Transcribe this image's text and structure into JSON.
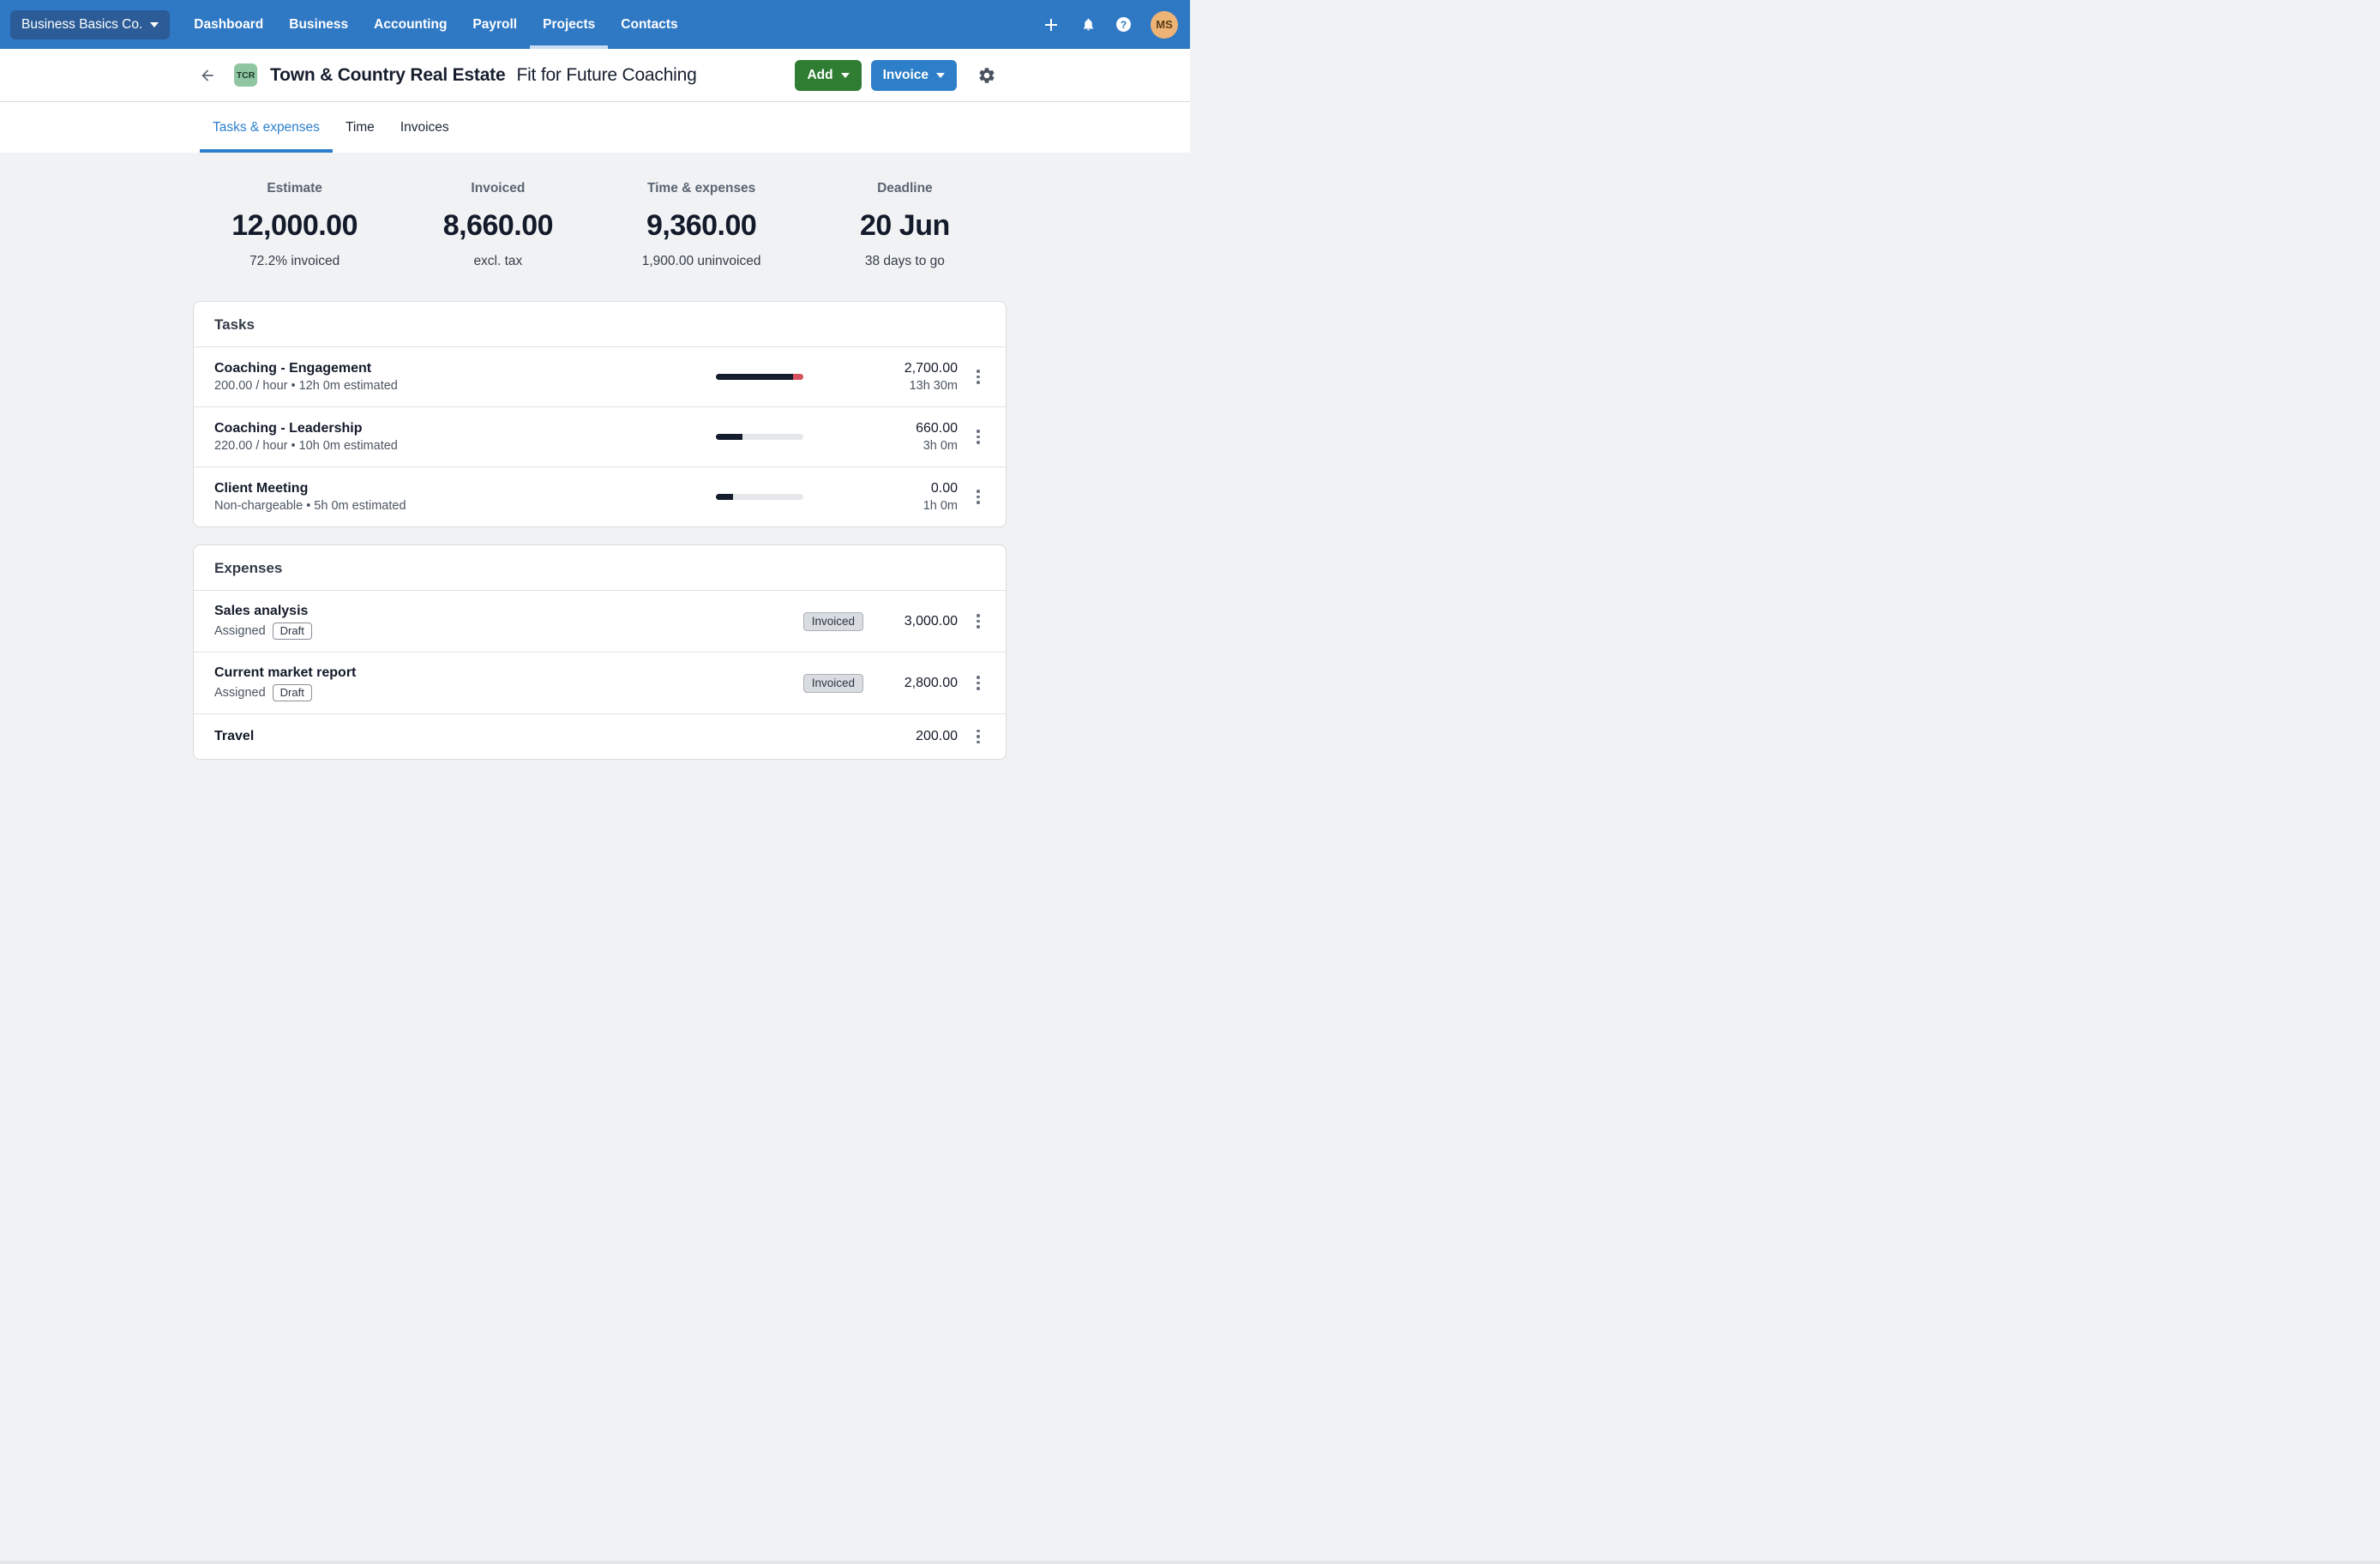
{
  "nav": {
    "org_label": "Business Basics Co.",
    "items": [
      "Dashboard",
      "Business",
      "Accounting",
      "Payroll",
      "Projects",
      "Contacts"
    ],
    "active_item": "Projects",
    "icons": [
      "plus-icon",
      "bell-icon",
      "help-icon"
    ],
    "avatar_initials": "MS"
  },
  "header": {
    "badge": "TCR",
    "title": "Town & Country Real Estate",
    "subtitle": "Fit for Future Coaching",
    "add_label": "Add",
    "invoice_label": "Invoice"
  },
  "tabs": [
    "Tasks & expenses",
    "Time",
    "Invoices"
  ],
  "active_tab": "Tasks & expenses",
  "stats": [
    {
      "label": "Estimate",
      "value": "12,000.00",
      "sub": "72.2% invoiced"
    },
    {
      "label": "Invoiced",
      "value": "8,660.00",
      "sub": "excl. tax"
    },
    {
      "label": "Time & expenses",
      "value": "9,360.00",
      "sub": "1,900.00 uninvoiced"
    },
    {
      "label": "Deadline",
      "value": "20 Jun",
      "sub": "38 days to go"
    }
  ],
  "tasks": {
    "title": "Tasks",
    "rows": [
      {
        "name": "Coaching - Engagement",
        "detail": "200.00 / hour • 12h 0m estimated",
        "amount": "2,700.00",
        "time": "13h 30m",
        "progress_dark_pct": 88,
        "progress_red_pct": 12
      },
      {
        "name": "Coaching - Leadership",
        "detail": "220.00 / hour • 10h 0m estimated",
        "amount": "660.00",
        "time": "3h 0m",
        "progress_dark_pct": 30,
        "progress_red_pct": 0
      },
      {
        "name": "Client Meeting",
        "detail": "Non-chargeable • 5h 0m estimated",
        "amount": "0.00",
        "time": "1h 0m",
        "progress_dark_pct": 20,
        "progress_red_pct": 0
      }
    ]
  },
  "expenses": {
    "title": "Expenses",
    "rows": [
      {
        "name": "Sales analysis",
        "assigned": "Assigned",
        "draft_badge": "Draft",
        "status_badge": "Invoiced",
        "amount": "3,000.00"
      },
      {
        "name": "Current market report",
        "assigned": "Assigned",
        "draft_badge": "Draft",
        "status_badge": "Invoiced",
        "amount": "2,800.00"
      },
      {
        "name": "Travel",
        "amount": "200.00"
      }
    ]
  },
  "colors": {
    "nav_blue": "#2F78C4",
    "org_button_blue": "#2B5C97",
    "active_nav_indicator": "#C9DDF2",
    "add_green": "#2E7D33",
    "invoice_blue": "#2E7FC9",
    "tab_active_blue": "#2B7FCE",
    "badge_green": "#90C5A1",
    "avatar_tan": "#EDB476",
    "progress_dark": "#141C2E",
    "progress_overrun_red": "#D8505D",
    "page_background": "#F1F2F4"
  }
}
